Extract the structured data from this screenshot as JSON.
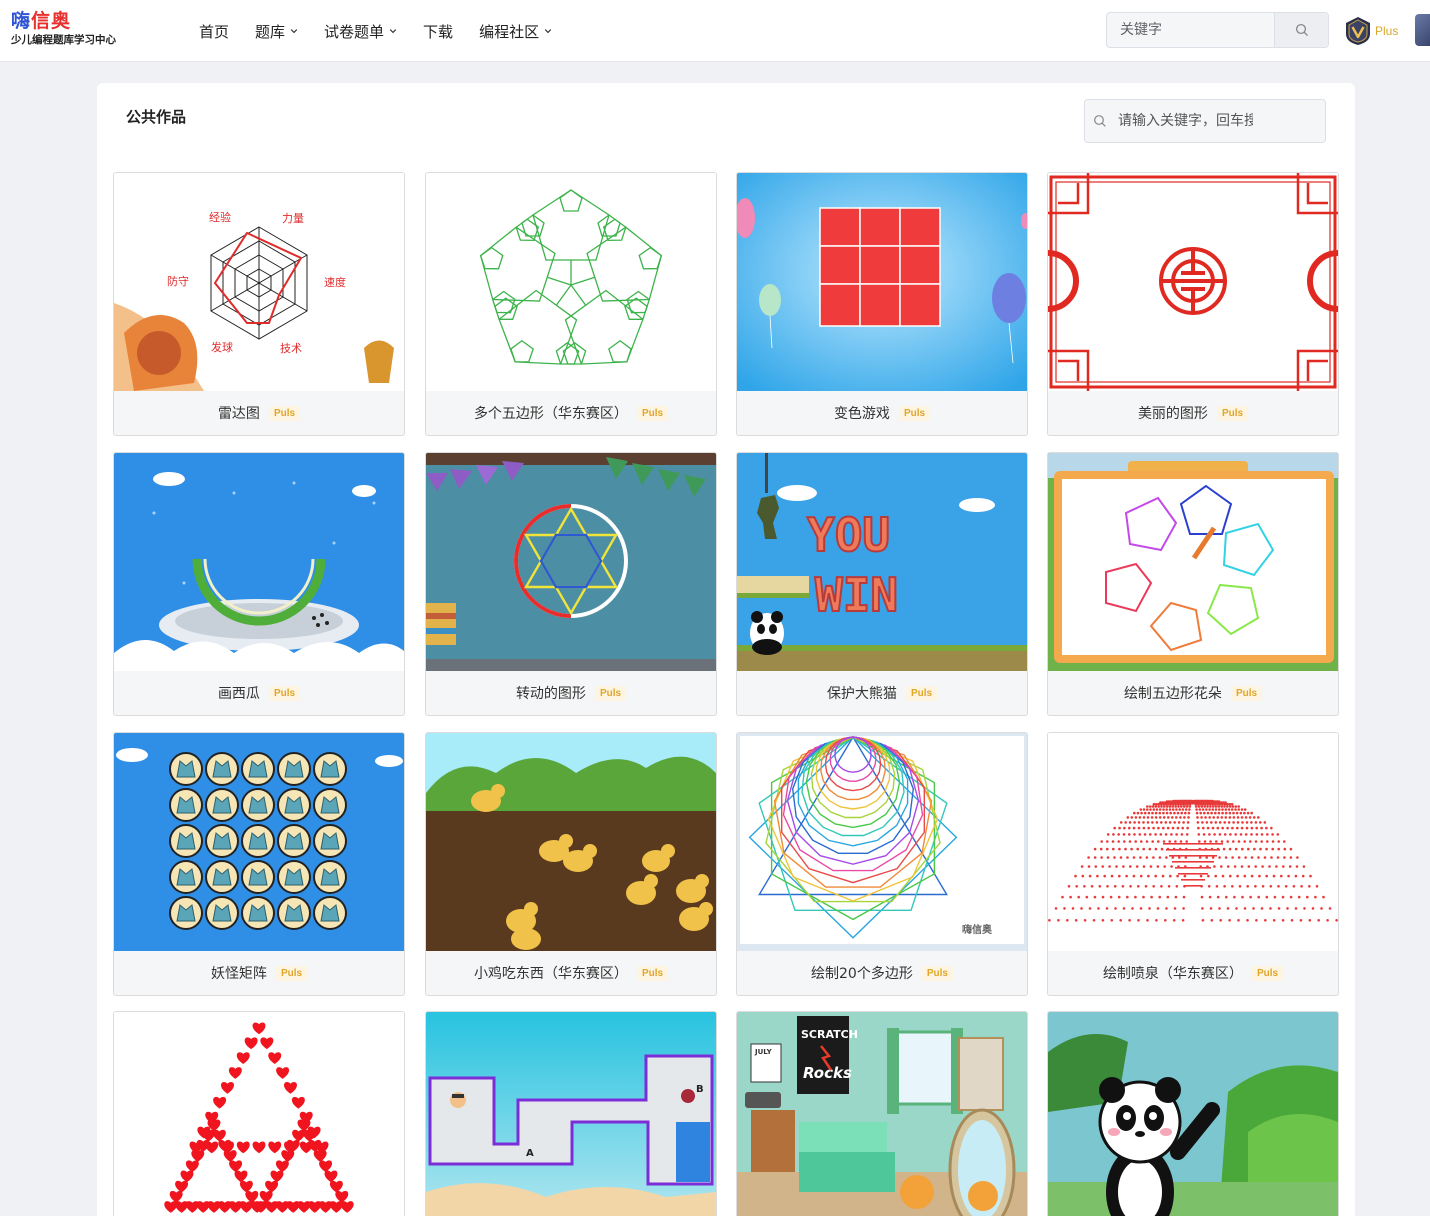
{
  "header": {
    "logo_brand_a": "嗨",
    "logo_brand_b": "信奥",
    "logo_slogan": "少儿编程题库学习中心",
    "nav": [
      {
        "label": "首页",
        "dropdown": false
      },
      {
        "label": "题库",
        "dropdown": true
      },
      {
        "label": "试卷题单",
        "dropdown": true
      },
      {
        "label": "下载",
        "dropdown": false
      },
      {
        "label": "编程社区",
        "dropdown": true
      }
    ],
    "search_placeholder": "关键字",
    "search_icon": "search-icon",
    "plus_label": "Plus"
  },
  "main": {
    "title": "公共作品",
    "search_placeholder": "请输入关键字，回车搜索"
  },
  "works": [
    {
      "title": "雷达图",
      "tag": "Puls"
    },
    {
      "title": "多个五边形（华东赛区）",
      "tag": "Puls"
    },
    {
      "title": "变色游戏",
      "tag": "Puls"
    },
    {
      "title": "美丽的图形",
      "tag": "Puls"
    },
    {
      "title": "画西瓜",
      "tag": "Puls"
    },
    {
      "title": "转动的图形",
      "tag": "Puls"
    },
    {
      "title": "保护大熊猫",
      "tag": "Puls"
    },
    {
      "title": "绘制五边形花朵",
      "tag": "Puls"
    },
    {
      "title": "妖怪矩阵",
      "tag": "Puls"
    },
    {
      "title": "小鸡吃东西（华东赛区）",
      "tag": "Puls"
    },
    {
      "title": "绘制20个多边形",
      "tag": "Puls"
    },
    {
      "title": "绘制喷泉（华东赛区）",
      "tag": "Puls"
    },
    {
      "title": "",
      "tag": ""
    },
    {
      "title": "",
      "tag": ""
    },
    {
      "title": "",
      "tag": ""
    },
    {
      "title": "",
      "tag": ""
    }
  ],
  "radar_labels": [
    "经验",
    "力量",
    "速度",
    "技术",
    "发球",
    "防守"
  ],
  "you_win": [
    "YOU",
    "WIN"
  ],
  "watermark": "嗨信奥",
  "scratch_poster": [
    "SCRATCH",
    "Rocks"
  ],
  "maze_labels": [
    "A",
    "B"
  ],
  "calendar_label": "JULY",
  "colors": {
    "brand_blue": "#2f55d4",
    "brand_red": "#e8312f",
    "tag_gold": "#e0a62c",
    "sky_blue": "#3aa3e8"
  }
}
